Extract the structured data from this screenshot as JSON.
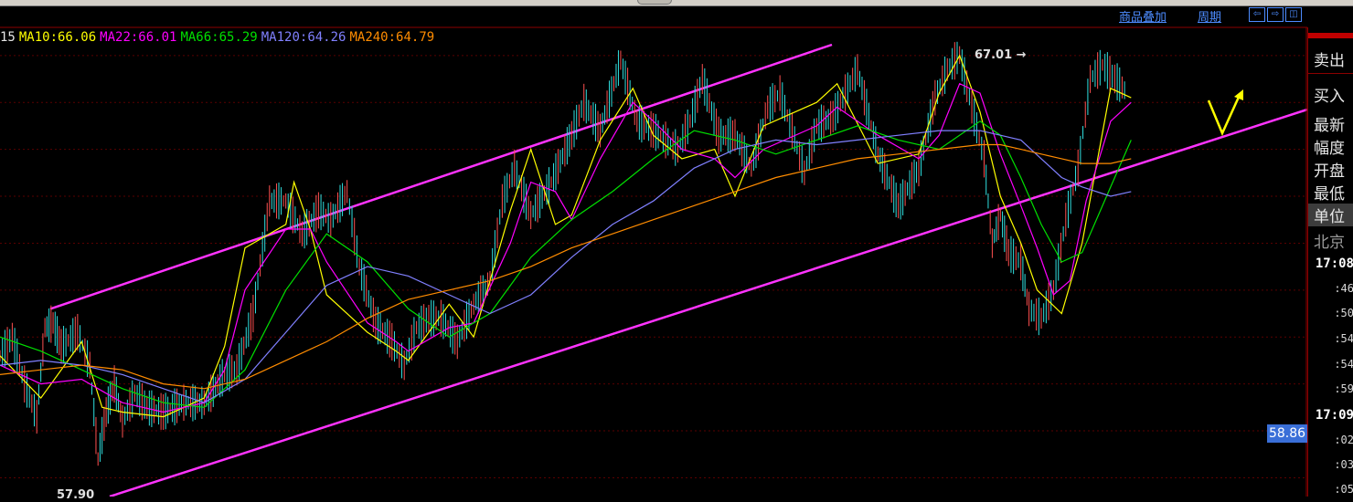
{
  "toolbar": {
    "overlay": "商品叠加",
    "period": "周期"
  },
  "legend": [
    {
      "text": "15",
      "color": "#e6e6e6"
    },
    {
      "text": "MA10:66.06",
      "color": "#ffff00"
    },
    {
      "text": "MA22:66.01",
      "color": "#ff00ff"
    },
    {
      "text": "MA66:65.29",
      "color": "#00e000"
    },
    {
      "text": "MA120:64.26",
      "color": "#8080ff"
    },
    {
      "text": "MA240:64.79",
      "color": "#ff8c00"
    }
  ],
  "sidebar": {
    "sell": "卖出",
    "buy": "买入",
    "latest": "最新",
    "range": "幅度",
    "open": "开盘",
    "low": "最低",
    "unit": "单位",
    "city": "北京",
    "times": [
      {
        "t": "17:08",
        "major": true
      },
      {
        "t": ":46",
        "major": false
      },
      {
        "t": ":50",
        "major": false
      },
      {
        "t": ":54",
        "major": false
      },
      {
        "t": ":54",
        "major": false
      },
      {
        "t": ":59",
        "major": false
      },
      {
        "t": "17:09",
        "major": true
      },
      {
        "t": ":02",
        "major": false
      },
      {
        "t": ":03",
        "major": false
      },
      {
        "t": ":05",
        "major": false
      }
    ]
  },
  "current_price": "58.86",
  "annotations": {
    "high": "67.01",
    "low": "57.90"
  },
  "chart_data": {
    "type": "line",
    "title": "",
    "ylim": [
      57.6,
      67.6
    ],
    "grid": true,
    "xlim": [
      0,
      300
    ],
    "series": [
      {
        "name": "MA10",
        "color": "#ffff00",
        "x": [
          0,
          10,
          20,
          25,
          30,
          40,
          50,
          55,
          60,
          70,
          72,
          76,
          80,
          90,
          97,
          100,
          110,
          116,
          125,
          130,
          136,
          140,
          147,
          155,
          160,
          167,
          175,
          180,
          187,
          200,
          205,
          215,
          225,
          230,
          235,
          240,
          245,
          250,
          254,
          260,
          265,
          272,
          277
        ],
        "y": [
          60.6,
          59.7,
          60.9,
          59.5,
          59.4,
          59.3,
          59.7,
          60.8,
          62.9,
          63.4,
          64.3,
          63.3,
          61.9,
          61.1,
          60.7,
          60.5,
          61.7,
          61.0,
          63.7,
          65.0,
          63.4,
          63.6,
          65.2,
          66.3,
          65.3,
          64.8,
          65.0,
          64.0,
          65.5,
          66.0,
          66.4,
          64.7,
          64.9,
          66.2,
          67.0,
          65.8,
          64.0,
          63.0,
          62.0,
          61.5,
          63.0,
          66.3,
          66.1
        ]
      },
      {
        "name": "MA22",
        "color": "#ff00ff",
        "x": [
          0,
          10,
          20,
          30,
          40,
          50,
          55,
          60,
          70,
          76,
          80,
          90,
          97,
          100,
          110,
          116,
          125,
          130,
          136,
          140,
          147,
          155,
          160,
          167,
          175,
          180,
          187,
          200,
          205,
          215,
          225,
          230,
          235,
          240,
          245,
          250,
          254,
          258,
          262,
          266,
          272,
          277
        ],
        "y": [
          60.4,
          60.0,
          60.1,
          59.6,
          59.4,
          59.6,
          60.3,
          62.0,
          63.3,
          63.3,
          62.6,
          61.3,
          60.9,
          60.7,
          61.2,
          61.3,
          63.0,
          64.3,
          64.1,
          63.5,
          64.8,
          66.0,
          65.6,
          65.0,
          64.8,
          64.4,
          65.0,
          65.5,
          65.9,
          65.3,
          64.8,
          65.3,
          66.4,
          66.2,
          64.9,
          63.8,
          62.9,
          61.9,
          62.2,
          63.9,
          65.6,
          66.0
        ]
      },
      {
        "name": "MA66",
        "color": "#00e000",
        "x": [
          0,
          10,
          20,
          30,
          40,
          50,
          60,
          70,
          80,
          90,
          100,
          110,
          120,
          130,
          140,
          150,
          160,
          170,
          180,
          190,
          200,
          210,
          220,
          230,
          240,
          245,
          250,
          255,
          260,
          265,
          272,
          277
        ],
        "y": [
          61.0,
          60.7,
          60.3,
          59.9,
          59.6,
          59.5,
          60.3,
          62.0,
          63.2,
          62.6,
          61.6,
          61.0,
          61.5,
          62.7,
          63.5,
          64.1,
          64.8,
          65.4,
          65.2,
          64.9,
          65.2,
          65.5,
          65.2,
          65.0,
          65.6,
          65.3,
          64.4,
          63.4,
          62.6,
          62.8,
          64.2,
          65.2
        ]
      },
      {
        "name": "MA120",
        "color": "#8080ff",
        "x": [
          0,
          10,
          20,
          30,
          40,
          50,
          60,
          70,
          80,
          90,
          100,
          110,
          120,
          130,
          140,
          150,
          160,
          170,
          180,
          190,
          200,
          210,
          220,
          230,
          240,
          245,
          250,
          255,
          260,
          265,
          272,
          277
        ],
        "y": [
          60.4,
          60.5,
          60.4,
          60.2,
          59.9,
          59.6,
          60.1,
          61.1,
          62.1,
          62.5,
          62.3,
          61.9,
          61.5,
          61.9,
          62.7,
          63.4,
          63.9,
          64.6,
          65.0,
          65.2,
          65.1,
          65.2,
          65.3,
          65.4,
          65.4,
          65.3,
          65.2,
          64.8,
          64.4,
          64.2,
          64.0,
          64.1
        ]
      },
      {
        "name": "MA240",
        "color": "#ff8c00",
        "x": [
          0,
          10,
          20,
          30,
          40,
          50,
          55,
          60,
          70,
          80,
          90,
          100,
          110,
          120,
          130,
          140,
          150,
          160,
          170,
          180,
          190,
          200,
          210,
          220,
          230,
          240,
          245,
          250,
          255,
          260,
          265,
          272,
          277
        ],
        "y": [
          60.2,
          60.3,
          60.4,
          60.3,
          60.0,
          59.9,
          60.0,
          60.1,
          60.5,
          60.9,
          61.4,
          61.8,
          62.0,
          62.2,
          62.5,
          62.9,
          63.2,
          63.5,
          63.8,
          64.1,
          64.4,
          64.6,
          64.8,
          64.9,
          65.0,
          65.1,
          65.1,
          65.0,
          64.9,
          64.8,
          64.7,
          64.7,
          64.8
        ]
      }
    ],
    "price": {
      "name": "price",
      "color": "#30e0e0",
      "x": [
        0,
        3,
        6,
        9,
        11,
        13,
        15,
        19,
        22,
        24,
        26,
        28,
        30,
        33,
        36,
        40,
        45,
        50,
        55,
        58,
        62,
        66,
        70,
        74,
        78,
        81,
        85,
        88,
        92,
        96,
        99,
        102,
        105,
        108,
        112,
        116,
        120,
        123,
        126,
        130,
        135,
        140,
        143,
        147,
        152,
        156,
        160,
        163,
        166,
        169,
        172,
        176,
        180,
        184,
        188,
        191,
        194,
        197,
        200,
        204,
        207,
        210,
        215,
        220,
        225,
        229,
        232,
        235,
        238,
        241,
        243,
        245,
        247,
        250,
        252,
        255,
        258,
        261,
        264,
        267,
        270,
        273,
        276
      ],
      "y": [
        60.6,
        61.0,
        60.0,
        59.3,
        61.2,
        61.3,
        60.8,
        61.1,
        60.4,
        58.4,
        59.4,
        60.0,
        59.2,
        59.8,
        59.5,
        59.4,
        59.6,
        59.6,
        60.2,
        60.3,
        61.5,
        63.9,
        63.9,
        63.2,
        63.7,
        63.5,
        64.1,
        62.5,
        61.3,
        60.9,
        60.4,
        61.2,
        61.4,
        61.4,
        60.9,
        61.7,
        62.2,
        63.9,
        64.6,
        63.6,
        64.3,
        65.3,
        66.0,
        65.4,
        66.9,
        65.6,
        65.4,
        65.2,
        65.0,
        65.6,
        66.5,
        65.3,
        65.3,
        64.6,
        65.9,
        66.2,
        65.4,
        64.5,
        65.5,
        65.7,
        66.2,
        66.7,
        64.9,
        63.8,
        64.6,
        66.1,
        66.7,
        67.01,
        65.9,
        64.8,
        63.0,
        63.6,
        62.8,
        62.6,
        61.6,
        61.4,
        62.0,
        63.5,
        64.6,
        66.5,
        66.8,
        66.5,
        66.2
      ]
    }
  }
}
